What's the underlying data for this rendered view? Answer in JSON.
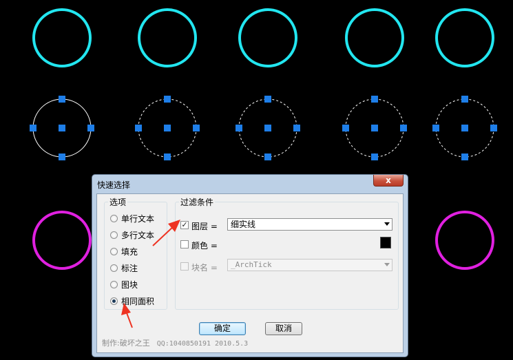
{
  "colors": {
    "background": "#000000",
    "circle_cyan": "#22e6f0",
    "circle_magenta": "#e020e0",
    "grip_blue": "#1e7ee8",
    "circle_selected": "#ffffff",
    "arrow_red": "#ee3322"
  },
  "drawing": {
    "rows": [
      {
        "name": "cyan-circles",
        "style": "solid",
        "count": 5
      },
      {
        "name": "selected-circles",
        "style": "dashed-with-grips",
        "count": 5
      },
      {
        "name": "magenta-circles",
        "style": "solid",
        "count": 2
      }
    ]
  },
  "dialog": {
    "title": "快速选择",
    "close_label": "x",
    "options": {
      "legend": "选项",
      "items": [
        {
          "label": "单行文本",
          "checked": false
        },
        {
          "label": "多行文本",
          "checked": false
        },
        {
          "label": "填充",
          "checked": false
        },
        {
          "label": "标注",
          "checked": false
        },
        {
          "label": "图块",
          "checked": false
        },
        {
          "label": "相同面积",
          "checked": true
        }
      ]
    },
    "filter": {
      "legend": "过滤条件",
      "layer_label": "图层 =",
      "layer_checked": true,
      "layer_value": "细实线",
      "color_label": "颜色 =",
      "color_checked": false,
      "color_value": "#000000",
      "block_label": "块名 =",
      "block_checked": false,
      "block_value": "_ArchTick"
    },
    "ok_label": "确定",
    "cancel_label": "取消",
    "footer": {
      "author": "制作:破坏之王",
      "info": "QQ:1040850191  2010.5.3"
    }
  }
}
